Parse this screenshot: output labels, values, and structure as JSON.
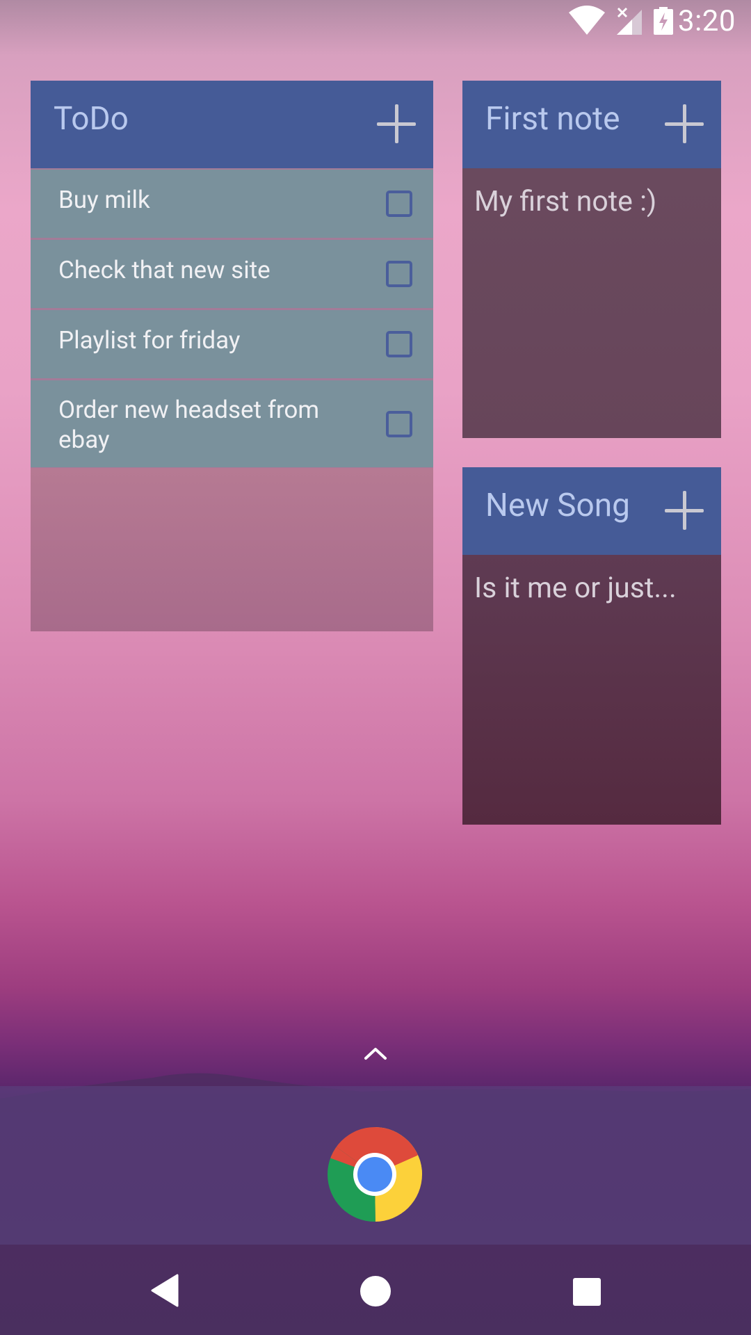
{
  "status_bar": {
    "time": "3:20",
    "icons": [
      "wifi-icon",
      "signal-icon",
      "battery-charging-icon"
    ]
  },
  "widgets": {
    "todo": {
      "title": "ToDo",
      "items": [
        {
          "text": "Buy milk",
          "checked": false
        },
        {
          "text": "Check that new site",
          "checked": false
        },
        {
          "text": "Playlist for friday",
          "checked": false
        },
        {
          "text": "Order new headset from ebay",
          "checked": false
        }
      ]
    },
    "note1": {
      "title": "First note",
      "body": "My first note :)"
    },
    "note2": {
      "title": "New Song",
      "body": "Is it me or just..."
    }
  },
  "launcher": {
    "drawer_icon": "chevron-up-icon",
    "dock_apps": [
      "chrome-icon"
    ]
  },
  "nav_bar": {
    "icons": [
      "back-icon",
      "home-icon",
      "recents-icon"
    ]
  },
  "colors": {
    "widget_header": "#455b97",
    "todo_item_bg": "#7a919c",
    "note_bg_top": "#6a4a5e",
    "note_bg_bottom": "#552a40"
  }
}
